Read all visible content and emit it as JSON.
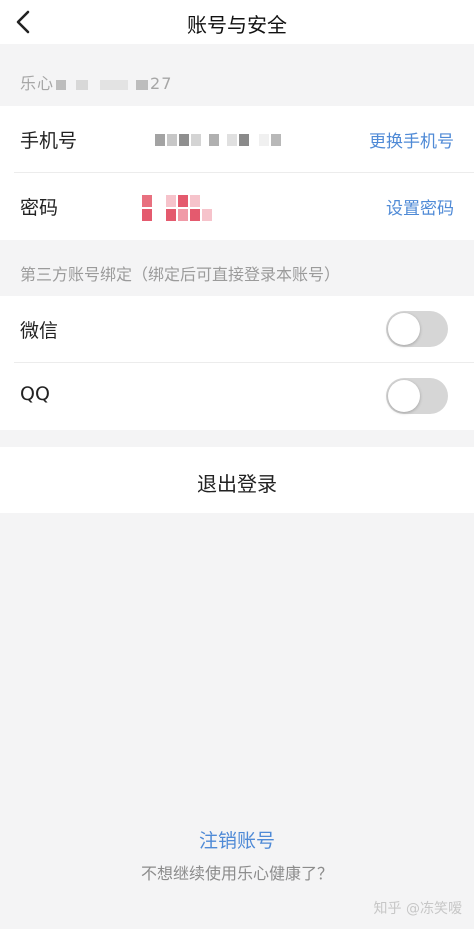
{
  "header": {
    "title": "账号与安全",
    "back_icon": "chevron-left-icon"
  },
  "account": {
    "id_prefix": "乐心",
    "id_suffix": "27"
  },
  "security": {
    "phone": {
      "label": "手机号",
      "action": "更换手机号"
    },
    "password": {
      "label": "密码",
      "action": "设置密码"
    }
  },
  "third_party": {
    "hint": "第三方账号绑定（绑定后可直接登录本账号）",
    "items": [
      {
        "label": "微信",
        "enabled": false
      },
      {
        "label": "QQ",
        "enabled": false
      }
    ]
  },
  "logout": {
    "label": "退出登录"
  },
  "footer": {
    "delete_label": "注销账号",
    "delete_hint": "不想继续使用乐心健康了？",
    "watermark": "知乎 @冻笑嗳"
  },
  "colors": {
    "link": "#4f8ad6",
    "background": "#f4f4f5",
    "toggle_off": "#d6d6d6",
    "mask_gray": "#9e9e9e",
    "mask_pink": "#e45a6e"
  }
}
